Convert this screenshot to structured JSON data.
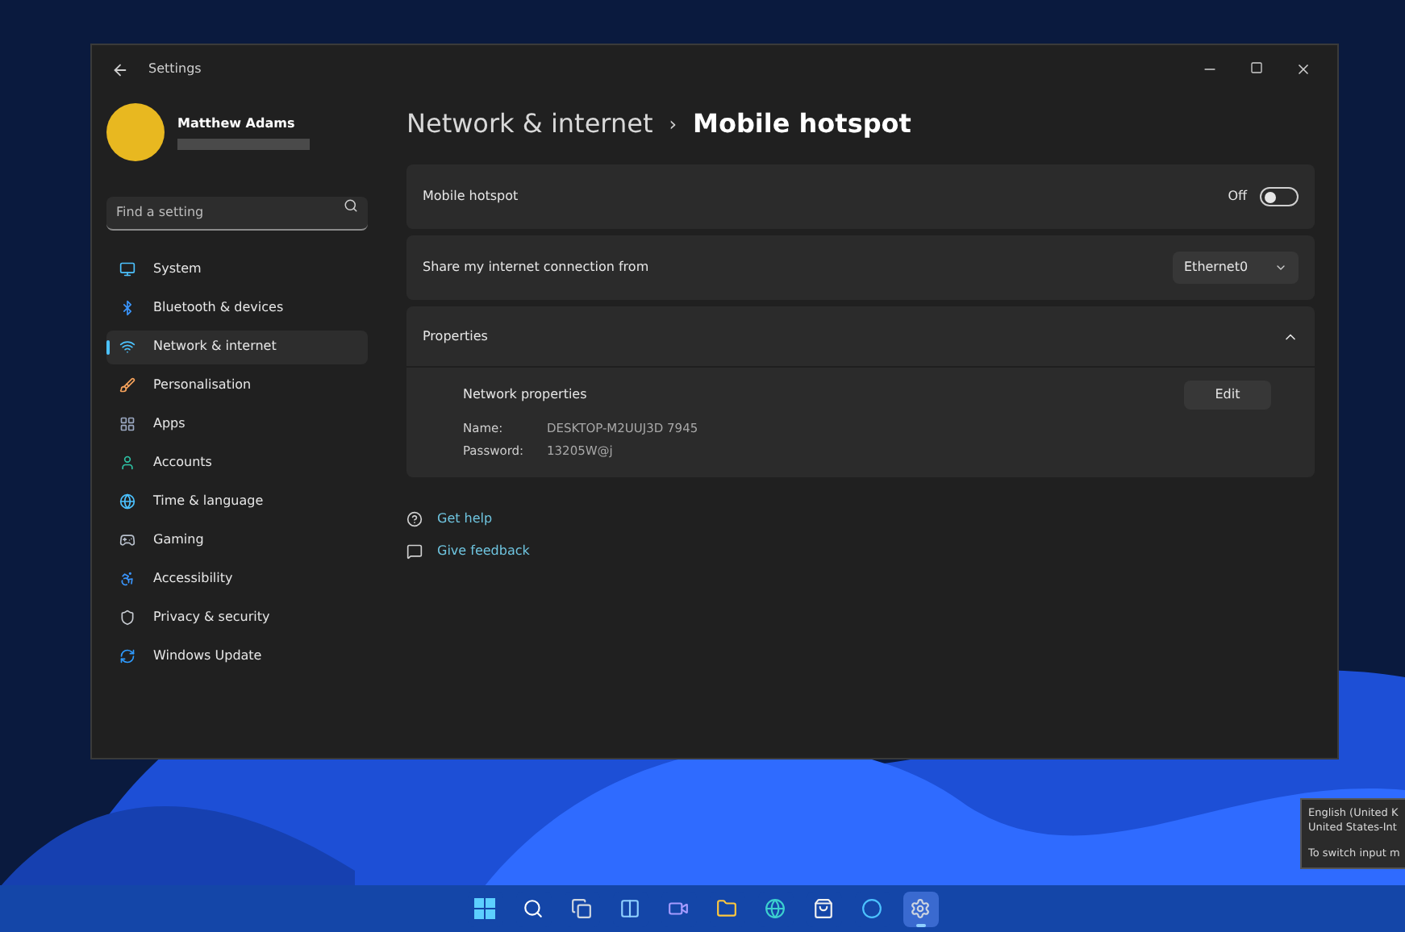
{
  "window": {
    "title": "Settings"
  },
  "user": {
    "name": "Matthew Adams"
  },
  "search": {
    "placeholder": "Find a setting"
  },
  "sidebar": {
    "items": [
      {
        "kind": "system",
        "label": "System",
        "selected": false
      },
      {
        "kind": "bluetooth",
        "label": "Bluetooth & devices",
        "selected": false
      },
      {
        "kind": "network",
        "label": "Network & internet",
        "selected": true
      },
      {
        "kind": "personalisation",
        "label": "Personalisation",
        "selected": false
      },
      {
        "kind": "apps",
        "label": "Apps",
        "selected": false
      },
      {
        "kind": "accounts",
        "label": "Accounts",
        "selected": false
      },
      {
        "kind": "time",
        "label": "Time & language",
        "selected": false
      },
      {
        "kind": "gaming",
        "label": "Gaming",
        "selected": false
      },
      {
        "kind": "accessibility",
        "label": "Accessibility",
        "selected": false
      },
      {
        "kind": "privacy",
        "label": "Privacy & security",
        "selected": false
      },
      {
        "kind": "update",
        "label": "Windows Update",
        "selected": false
      }
    ]
  },
  "breadcrumb": {
    "parent": "Network & internet",
    "separator": "›",
    "current": "Mobile hotspot"
  },
  "hotspot": {
    "label": "Mobile hotspot",
    "state_text": "Off",
    "on": false
  },
  "share": {
    "label": "Share my internet connection from",
    "value": "Ethernet0"
  },
  "properties": {
    "label": "Properties",
    "expanded": true,
    "section_title": "Network properties",
    "edit_button": "Edit",
    "fields": [
      {
        "label": "Name:",
        "value": "DESKTOP-M2UUJ3D 7945"
      },
      {
        "label": "Password:",
        "value": "13205W@j"
      }
    ]
  },
  "links": [
    {
      "kind": "help",
      "label": "Get help"
    },
    {
      "kind": "feedback",
      "label": "Give feedback"
    }
  ],
  "tooltip": {
    "lines": [
      "English (United K",
      "United States-Int"
    ],
    "hint": "To switch input m"
  },
  "taskbar": {
    "items": [
      {
        "kind": "start",
        "active": false
      },
      {
        "kind": "search",
        "active": false
      },
      {
        "kind": "taskview",
        "active": false
      },
      {
        "kind": "widgets",
        "active": false
      },
      {
        "kind": "chat",
        "active": false
      },
      {
        "kind": "explorer",
        "active": false
      },
      {
        "kind": "edge",
        "active": false
      },
      {
        "kind": "store",
        "active": false
      },
      {
        "kind": "cortana",
        "active": false
      },
      {
        "kind": "settings",
        "active": true
      }
    ]
  }
}
